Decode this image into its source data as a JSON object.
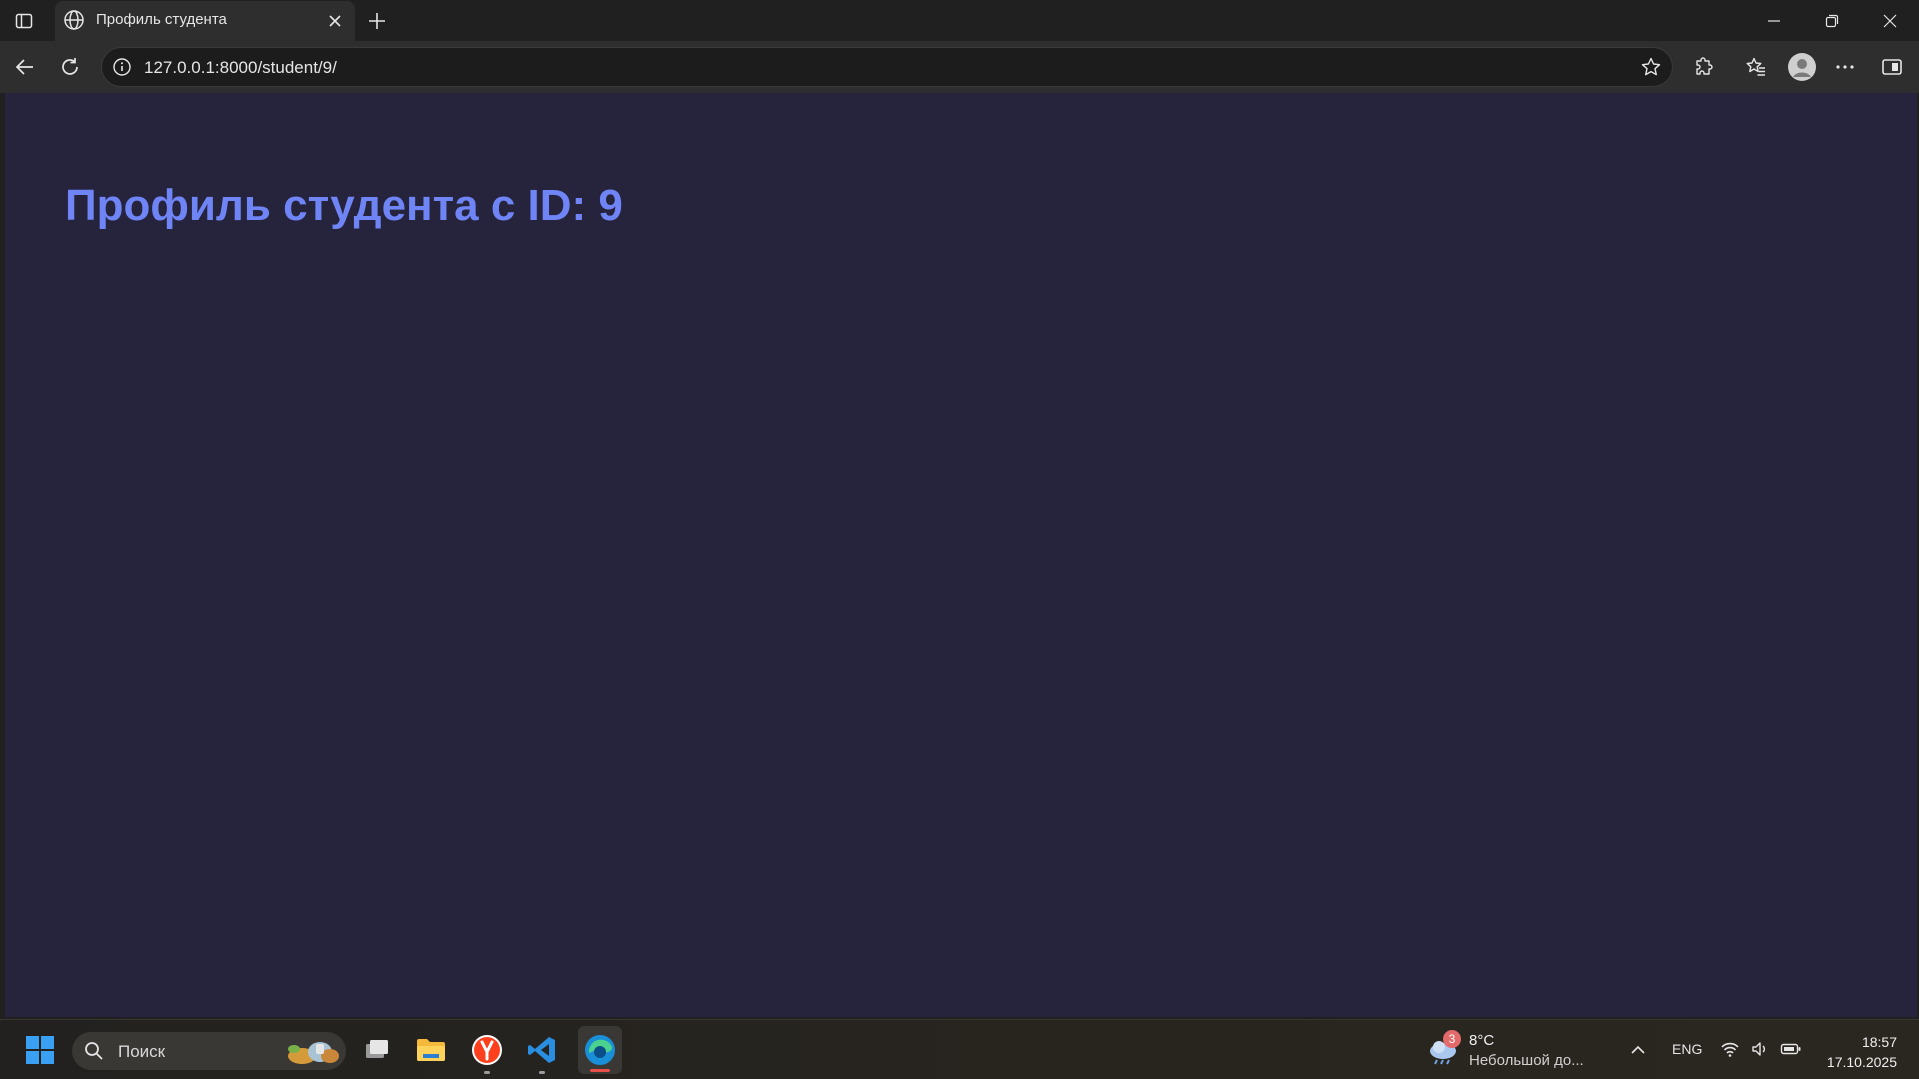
{
  "browser": {
    "tab": {
      "title": "Профиль студента"
    },
    "address_bar": {
      "url": "127.0.0.1:8000/student/9/"
    }
  },
  "page": {
    "heading": "Профиль студента с ID: 9",
    "colors": {
      "background": "#26233d",
      "heading": "#6f84f5"
    }
  },
  "taskbar": {
    "search": {
      "placeholder": "Поиск"
    },
    "weather": {
      "badge": "3",
      "temperature": "8°C",
      "condition": "Небольшой до..."
    },
    "language": "ENG",
    "clock": {
      "time": "18:57",
      "date": "17.10.2025"
    },
    "apps": [
      "task-view",
      "file-explorer",
      "yandex-browser",
      "vscode",
      "edge"
    ]
  }
}
